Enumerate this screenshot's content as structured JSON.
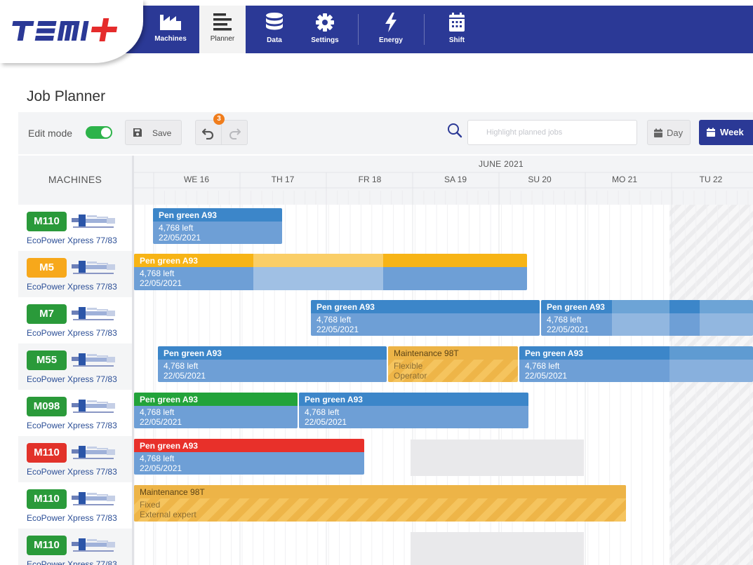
{
  "app": {
    "logo_text": "TEMI+"
  },
  "nav": [
    {
      "id": "machines",
      "label": "Machines",
      "icon": "machines-icon",
      "active": false
    },
    {
      "id": "planner",
      "label": "Planner",
      "icon": "planner-icon",
      "active": true
    },
    {
      "id": "data",
      "label": "Data",
      "icon": "data-icon",
      "active": false
    },
    {
      "id": "settings",
      "label": "Settings",
      "icon": "settings-icon",
      "active": false
    },
    {
      "id": "energy",
      "label": "Energy",
      "icon": "energy-icon",
      "active": false
    },
    {
      "id": "shift",
      "label": "Shift",
      "icon": "shift-icon",
      "active": false
    }
  ],
  "page": {
    "title": "Job Planner"
  },
  "toolbar": {
    "edit_mode_label": "Edit mode",
    "edit_mode_on": true,
    "save_label": "Save",
    "undo_count": "3",
    "search_placeholder": "Highlight planned jobs",
    "day_label": "Day",
    "week_label": "Week"
  },
  "machines_header": "MACHINES",
  "timeline": {
    "month": "JUNE 2021",
    "days": [
      "WE 16",
      "TH 17",
      "FR 18",
      "SA 19",
      "SU 20",
      "MO 21",
      "TU 22"
    ]
  },
  "machines": [
    {
      "code": "M110",
      "name": "EcoPower Xpress 77/83",
      "status_color": "#2a9a3a"
    },
    {
      "code": "M5",
      "name": "EcoPower Xpress 77/83",
      "status_color": "#f7a81b"
    },
    {
      "code": "M7",
      "name": "EcoPower Xpress 77/83",
      "status_color": "#2a9a3a"
    },
    {
      "code": "M55",
      "name": "EcoPower Xpress 77/83",
      "status_color": "#2a9a3a"
    },
    {
      "code": "M098",
      "name": "EcoPower Xpress 77/83",
      "status_color": "#2a9a3a"
    },
    {
      "code": "M110",
      "name": "EcoPower Xpress 77/83",
      "status_color": "#e2322a"
    },
    {
      "code": "M110",
      "name": "EcoPower Xpress 77/83",
      "status_color": "#2a9a3a"
    },
    {
      "code": "M110",
      "name": "EcoPower Xpress 77/83",
      "status_color": "#2a9a3a"
    }
  ],
  "jobs": [
    {
      "row": 0,
      "type": "job",
      "title": "Pen green A93",
      "line1": "4,768 left",
      "line2": "22/05/2021",
      "color": "#3c86c9"
    },
    {
      "row": 1,
      "type": "job",
      "title": "Pen green A93",
      "line1": "4,768 left",
      "line2": "22/05/2021",
      "color": "#f7b416"
    },
    {
      "row": 2,
      "type": "job",
      "title": "Pen green A93",
      "line1": "4,768 left",
      "line2": "22/05/2021",
      "color": "#3c86c9"
    },
    {
      "row": 2,
      "type": "job",
      "title": "Pen green A93",
      "line1": "4,768 left",
      "line2": "22/05/2021",
      "color": "#3c86c9"
    },
    {
      "row": 3,
      "type": "job",
      "title": "Pen green A93",
      "line1": "4,768 left",
      "line2": "22/05/2021",
      "color": "#3c86c9"
    },
    {
      "row": 3,
      "type": "maintenance",
      "title": "Maintenance 98T",
      "line1": "Flexible",
      "line2": "Operator",
      "color": "#edb447"
    },
    {
      "row": 3,
      "type": "job",
      "title": "Pen green A93",
      "line1": "4,768 left",
      "line2": "22/05/2021",
      "color": "#3c86c9"
    },
    {
      "row": 4,
      "type": "job",
      "title": "Pen green A93",
      "line1": "4,768 left",
      "line2": "22/05/2021",
      "color": "#22a33a"
    },
    {
      "row": 4,
      "type": "job",
      "title": "Pen green A93",
      "line1": "4,768 left",
      "line2": "22/05/2021",
      "color": "#3c86c9"
    },
    {
      "row": 5,
      "type": "job",
      "title": "Pen green A93",
      "line1": "4,768 left",
      "line2": "22/05/2021",
      "color": "#e8302a"
    },
    {
      "row": 6,
      "type": "maintenance",
      "title": "Maintenance 98T",
      "line1": "Fixed",
      "line2": "External expert",
      "color": "#edb447"
    }
  ],
  "colors": {
    "nav_bg": "#2b3996",
    "accent": "#2b3996",
    "job_blue": "#3c86c9",
    "job_light": "#6e9fd6",
    "maintenance": "#edb447",
    "toggle_on": "#2db34a",
    "badge_orange": "#f07d1c"
  }
}
